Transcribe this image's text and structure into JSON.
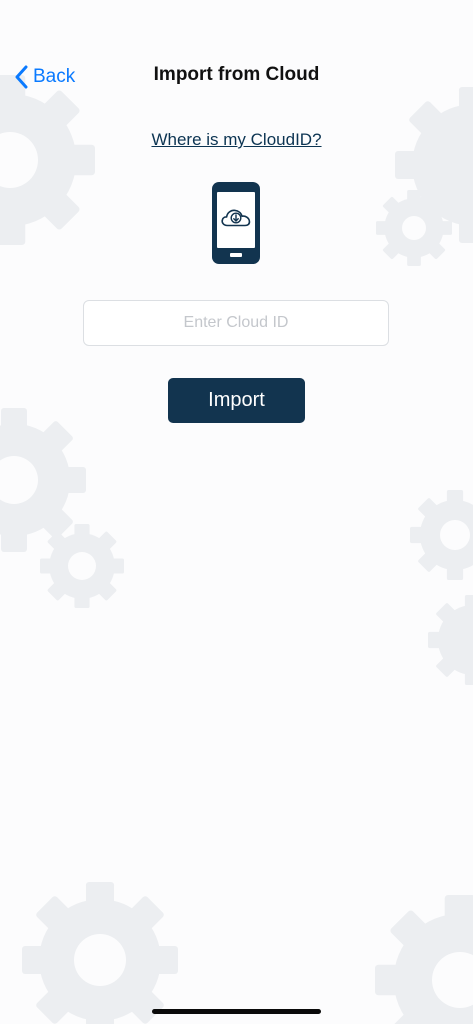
{
  "nav": {
    "back_label": "Back",
    "title": "Import from Cloud"
  },
  "help_link": "Where is my CloudID?",
  "illustration": {
    "icon": "phone-cloud-download-icon",
    "color": "#12344f"
  },
  "cloud_id_input": {
    "value": "",
    "placeholder": "Enter Cloud ID"
  },
  "import_button": {
    "label": "Import",
    "color": "#12344f"
  },
  "colors": {
    "accent": "#0a7aff",
    "link": "#0c3452",
    "background_gears": "#eceef1"
  }
}
